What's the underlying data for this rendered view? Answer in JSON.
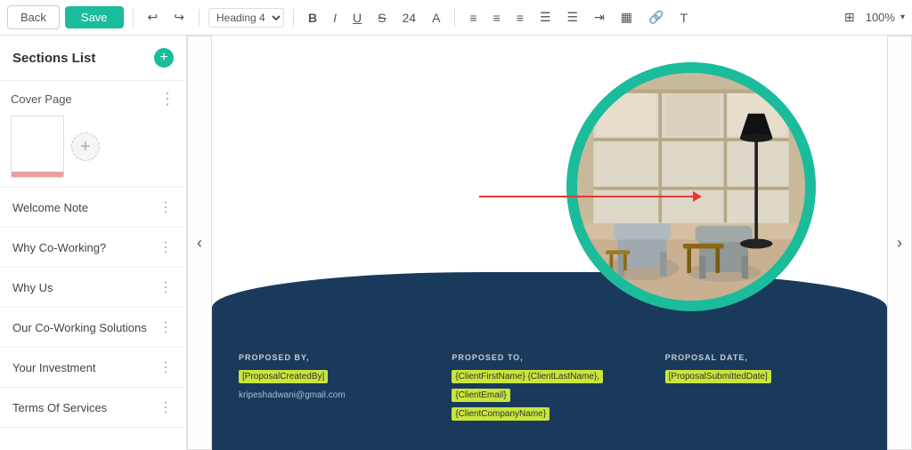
{
  "topbar": {
    "back_label": "Back",
    "save_label": "Save",
    "heading_type": "Heading 4",
    "font_size": "24",
    "zoom": "100%"
  },
  "sidebar": {
    "title": "Sections List",
    "add_btn_label": "+",
    "cover_label": "Cover Page",
    "sections": [
      {
        "id": 1,
        "label": "Welcome Note"
      },
      {
        "id": 2,
        "label": "Why Co-Working?"
      },
      {
        "id": 3,
        "label": "Why Us"
      },
      {
        "id": 4,
        "label": "Our Co-Working Solutions"
      },
      {
        "id": 5,
        "label": "Your Investment"
      },
      {
        "id": 6,
        "label": "Terms Of Services"
      }
    ]
  },
  "canvas": {
    "nav_left": "‹",
    "nav_right": "›"
  },
  "bottom": {
    "col1": {
      "label": "PROPOSED BY,",
      "field1": "[ProposalCreatedBy]",
      "field2": "kripeshadwani@gmail.com"
    },
    "col2": {
      "label": "PROPOSED To,",
      "field1": "{ClientFirstName} {ClientLastName},",
      "field2": "{ClientEmail}",
      "field3": "{ClientCompanyName}"
    },
    "col3": {
      "label": "PROPOSAL DATE,",
      "field1": "[ProposalSubmittedDate]"
    }
  }
}
